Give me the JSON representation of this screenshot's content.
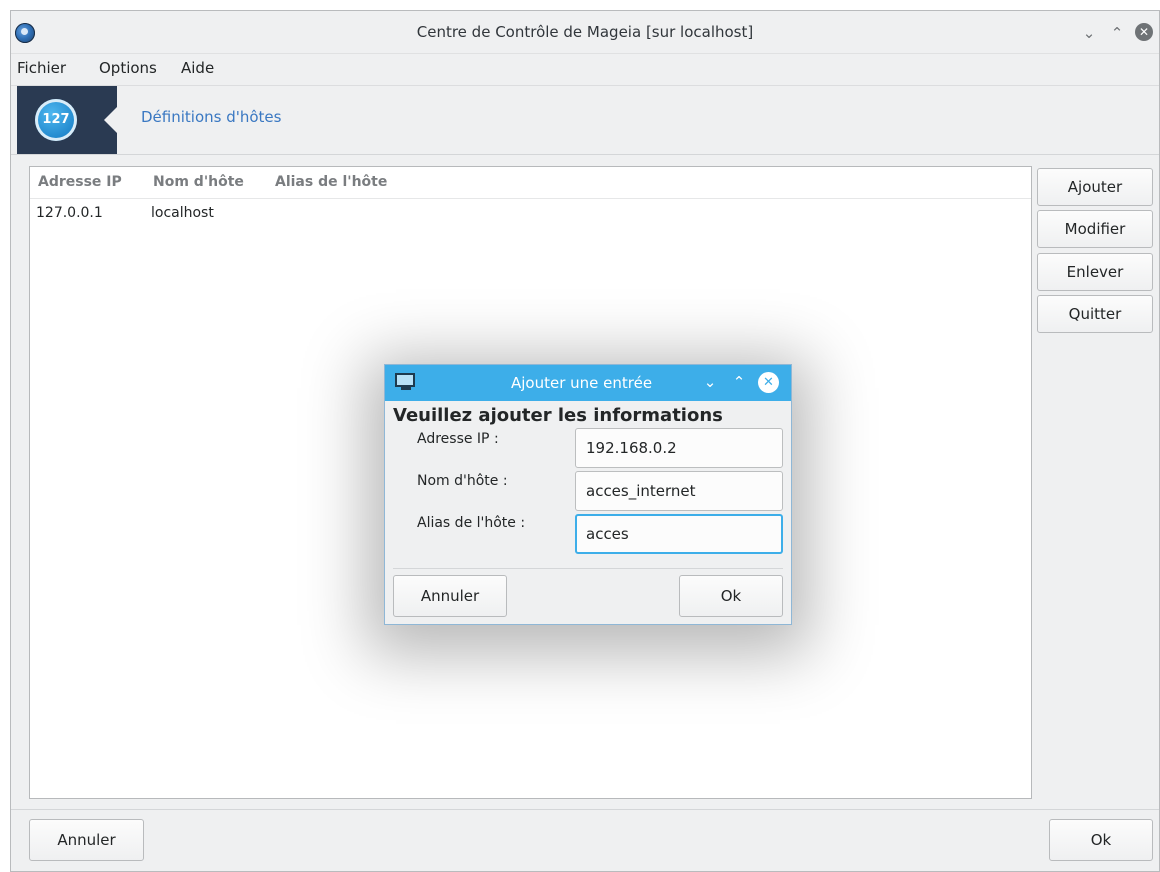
{
  "window": {
    "title": "Centre de Contrôle de Mageia [sur localhost]",
    "minimize_glyph": "⌄",
    "maximize_glyph": "⌃",
    "close_glyph": "✕"
  },
  "menubar": {
    "items": [
      {
        "label": "Fichier"
      },
      {
        "label": "Options"
      },
      {
        "label": "Aide"
      }
    ]
  },
  "banner": {
    "icon_text": "127",
    "title": "Définitions d'hôtes"
  },
  "table": {
    "columns": [
      "Adresse IP",
      "Nom d'hôte",
      "Alias de l'hôte"
    ],
    "rows": [
      [
        "127.0.0.1",
        "localhost",
        ""
      ]
    ]
  },
  "side_buttons": {
    "add": "Ajouter",
    "modify": "Modifier",
    "remove": "Enlever",
    "quit": "Quitter"
  },
  "footer": {
    "cancel": "Annuler",
    "ok": "Ok"
  },
  "dialog": {
    "title": "Ajouter une entrée",
    "heading": "Veuillez ajouter les informations",
    "fields": {
      "ip_label": "Adresse IP :",
      "ip_value": "192.168.0.2",
      "host_label": "Nom d'hôte :",
      "host_value": "acces_internet",
      "alias_label": "Alias de l'hôte :",
      "alias_value": "acces"
    },
    "cancel": "Annuler",
    "ok": "Ok"
  },
  "colors": {
    "accent": "#3daee9",
    "banner_dark": "#2a3a52",
    "link_blue": "#3a78c2"
  }
}
